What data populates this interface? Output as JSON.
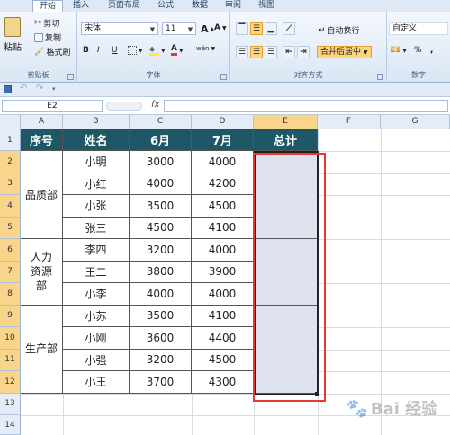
{
  "ribbon": {
    "tabs": [
      "开始",
      "插入",
      "页面布局",
      "公式",
      "数据",
      "审阅",
      "视图"
    ],
    "clipboard": {
      "paste": "粘贴",
      "cut": "剪切",
      "copy": "复制",
      "format_painter": "格式刷",
      "label": "剪贴板"
    },
    "font": {
      "name": "宋体",
      "size": "11",
      "grow": "A",
      "shrink": "A",
      "bold": "B",
      "italic": "I",
      "underline": "U",
      "wen": "wén",
      "label": "字体"
    },
    "alignment": {
      "wrap": "自动换行",
      "merge": "合并后居中",
      "label": "对齐方式"
    },
    "number": {
      "format": "自定义",
      "percent": "%",
      "comma": ",",
      "label": "数字"
    }
  },
  "formula_bar": {
    "name_box": "E2",
    "fx": "fx",
    "value": ""
  },
  "sheet": {
    "columns": [
      "A",
      "B",
      "C",
      "D",
      "E",
      "F",
      "G"
    ],
    "rows": [
      "1",
      "2",
      "3",
      "4",
      "5",
      "6",
      "7",
      "8",
      "9",
      "10",
      "11",
      "12",
      "13",
      "14"
    ],
    "headers": [
      "序号",
      "姓名",
      "6月",
      "7月",
      "总计"
    ],
    "departments": [
      {
        "name": "品质部"
      },
      {
        "name": "人力资源部"
      },
      {
        "name": "生产部"
      }
    ],
    "data": [
      {
        "name": "小明",
        "jun": "3000",
        "jul": "4000"
      },
      {
        "name": "小红",
        "jun": "4000",
        "jul": "4200"
      },
      {
        "name": "小张",
        "jun": "3500",
        "jul": "4500"
      },
      {
        "name": "张三",
        "jun": "4500",
        "jul": "4100"
      },
      {
        "name": "李四",
        "jun": "3200",
        "jul": "4000"
      },
      {
        "name": "王二",
        "jun": "3800",
        "jul": "3900"
      },
      {
        "name": "小李",
        "jun": "4000",
        "jul": "4000"
      },
      {
        "name": "小苏",
        "jun": "3500",
        "jul": "4100"
      },
      {
        "name": "小刚",
        "jun": "3600",
        "jul": "4400"
      },
      {
        "name": "小强",
        "jun": "3200",
        "jul": "4500"
      },
      {
        "name": "小王",
        "jun": "3700",
        "jul": "4300"
      }
    ],
    "selected_cell": "E2",
    "highlight_color": "#e53935",
    "header_color": "#1e5866"
  },
  "watermark": "Bai 经验"
}
